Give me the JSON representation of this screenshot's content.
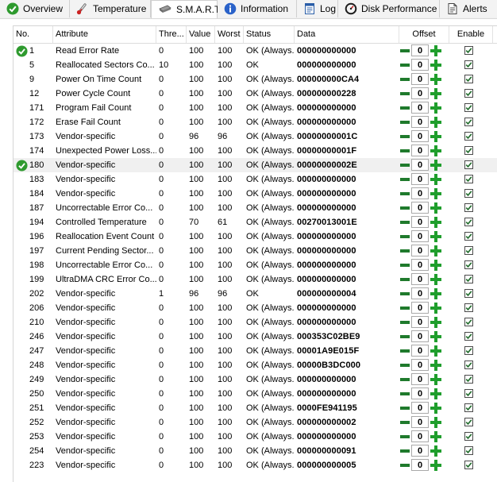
{
  "tabs": [
    {
      "label": "Overview",
      "icon": "check-circle-icon"
    },
    {
      "label": "Temperature",
      "icon": "thermometer-icon"
    },
    {
      "label": "S.M.A.R.T.",
      "icon": "drive-icon",
      "active": true
    },
    {
      "label": "Information",
      "icon": "info-icon"
    },
    {
      "label": "Log",
      "icon": "log-icon"
    },
    {
      "label": "Disk Performance",
      "icon": "speedometer-icon"
    },
    {
      "label": "Alerts",
      "icon": "alert-page-icon"
    }
  ],
  "columns": {
    "no": "No.",
    "attribute": "Attribute",
    "threshold": "Thre...",
    "value": "Value",
    "worst": "Worst",
    "status": "Status",
    "data": "Data",
    "offset": "Offset",
    "enable": "Enable"
  },
  "colors": {
    "ok_green": "#2e9a2e",
    "plus_green": "#1f9e2c",
    "minus_green": "#1f7a2c",
    "selected_row": "#f0f0f0"
  },
  "rows": [
    {
      "no": "1",
      "attr": "Read Error Rate",
      "thr": "0",
      "val": "100",
      "worst": "100",
      "status": "OK (Always...",
      "data": "000000000000",
      "offset": "0",
      "ok": true
    },
    {
      "no": "5",
      "attr": "Reallocated Sectors Co...",
      "thr": "10",
      "val": "100",
      "worst": "100",
      "status": "OK",
      "data": "000000000000",
      "offset": "0"
    },
    {
      "no": "9",
      "attr": "Power On Time Count",
      "thr": "0",
      "val": "100",
      "worst": "100",
      "status": "OK (Always...",
      "data": "000000000CA4",
      "offset": "0"
    },
    {
      "no": "12",
      "attr": "Power Cycle Count",
      "thr": "0",
      "val": "100",
      "worst": "100",
      "status": "OK (Always...",
      "data": "000000000228",
      "offset": "0"
    },
    {
      "no": "171",
      "attr": "Program Fail Count",
      "thr": "0",
      "val": "100",
      "worst": "100",
      "status": "OK (Always...",
      "data": "000000000000",
      "offset": "0"
    },
    {
      "no": "172",
      "attr": "Erase Fail Count",
      "thr": "0",
      "val": "100",
      "worst": "100",
      "status": "OK (Always...",
      "data": "000000000000",
      "offset": "0"
    },
    {
      "no": "173",
      "attr": "Vendor-specific",
      "thr": "0",
      "val": "96",
      "worst": "96",
      "status": "OK (Always...",
      "data": "00000000001C",
      "offset": "0"
    },
    {
      "no": "174",
      "attr": "Unexpected Power Loss...",
      "thr": "0",
      "val": "100",
      "worst": "100",
      "status": "OK (Always...",
      "data": "00000000001F",
      "offset": "0"
    },
    {
      "no": "180",
      "attr": "Vendor-specific",
      "thr": "0",
      "val": "100",
      "worst": "100",
      "status": "OK (Always...",
      "data": "00000000002E",
      "offset": "0",
      "ok": true,
      "selected": true
    },
    {
      "no": "183",
      "attr": "Vendor-specific",
      "thr": "0",
      "val": "100",
      "worst": "100",
      "status": "OK (Always...",
      "data": "000000000000",
      "offset": "0"
    },
    {
      "no": "184",
      "attr": "Vendor-specific",
      "thr": "0",
      "val": "100",
      "worst": "100",
      "status": "OK (Always...",
      "data": "000000000000",
      "offset": "0"
    },
    {
      "no": "187",
      "attr": "Uncorrectable Error Co...",
      "thr": "0",
      "val": "100",
      "worst": "100",
      "status": "OK (Always...",
      "data": "000000000000",
      "offset": "0"
    },
    {
      "no": "194",
      "attr": "Controlled Temperature",
      "thr": "0",
      "val": "70",
      "worst": "61",
      "status": "OK (Always...",
      "data": "00270013001E",
      "offset": "0"
    },
    {
      "no": "196",
      "attr": "Reallocation Event Count",
      "thr": "0",
      "val": "100",
      "worst": "100",
      "status": "OK (Always...",
      "data": "000000000000",
      "offset": "0"
    },
    {
      "no": "197",
      "attr": "Current Pending Sector...",
      "thr": "0",
      "val": "100",
      "worst": "100",
      "status": "OK (Always...",
      "data": "000000000000",
      "offset": "0"
    },
    {
      "no": "198",
      "attr": "Uncorrectable Error Co...",
      "thr": "0",
      "val": "100",
      "worst": "100",
      "status": "OK (Always...",
      "data": "000000000000",
      "offset": "0"
    },
    {
      "no": "199",
      "attr": "UltraDMA CRC Error Co...",
      "thr": "0",
      "val": "100",
      "worst": "100",
      "status": "OK (Always...",
      "data": "000000000000",
      "offset": "0"
    },
    {
      "no": "202",
      "attr": "Vendor-specific",
      "thr": "1",
      "val": "96",
      "worst": "96",
      "status": "OK",
      "data": "000000000004",
      "offset": "0"
    },
    {
      "no": "206",
      "attr": "Vendor-specific",
      "thr": "0",
      "val": "100",
      "worst": "100",
      "status": "OK (Always...",
      "data": "000000000000",
      "offset": "0"
    },
    {
      "no": "210",
      "attr": "Vendor-specific",
      "thr": "0",
      "val": "100",
      "worst": "100",
      "status": "OK (Always...",
      "data": "000000000000",
      "offset": "0"
    },
    {
      "no": "246",
      "attr": "Vendor-specific",
      "thr": "0",
      "val": "100",
      "worst": "100",
      "status": "OK (Always...",
      "data": "000353C02BE9",
      "offset": "0"
    },
    {
      "no": "247",
      "attr": "Vendor-specific",
      "thr": "0",
      "val": "100",
      "worst": "100",
      "status": "OK (Always...",
      "data": "00001A9E015F",
      "offset": "0"
    },
    {
      "no": "248",
      "attr": "Vendor-specific",
      "thr": "0",
      "val": "100",
      "worst": "100",
      "status": "OK (Always...",
      "data": "00000B3DC000",
      "offset": "0"
    },
    {
      "no": "249",
      "attr": "Vendor-specific",
      "thr": "0",
      "val": "100",
      "worst": "100",
      "status": "OK (Always...",
      "data": "000000000000",
      "offset": "0"
    },
    {
      "no": "250",
      "attr": "Vendor-specific",
      "thr": "0",
      "val": "100",
      "worst": "100",
      "status": "OK (Always...",
      "data": "000000000000",
      "offset": "0"
    },
    {
      "no": "251",
      "attr": "Vendor-specific",
      "thr": "0",
      "val": "100",
      "worst": "100",
      "status": "OK (Always...",
      "data": "0000FE941195",
      "offset": "0"
    },
    {
      "no": "252",
      "attr": "Vendor-specific",
      "thr": "0",
      "val": "100",
      "worst": "100",
      "status": "OK (Always...",
      "data": "000000000002",
      "offset": "0"
    },
    {
      "no": "253",
      "attr": "Vendor-specific",
      "thr": "0",
      "val": "100",
      "worst": "100",
      "status": "OK (Always...",
      "data": "000000000000",
      "offset": "0"
    },
    {
      "no": "254",
      "attr": "Vendor-specific",
      "thr": "0",
      "val": "100",
      "worst": "100",
      "status": "OK (Always...",
      "data": "000000000091",
      "offset": "0"
    },
    {
      "no": "223",
      "attr": "Vendor-specific",
      "thr": "0",
      "val": "100",
      "worst": "100",
      "status": "OK (Always...",
      "data": "000000000005",
      "offset": "0"
    }
  ]
}
